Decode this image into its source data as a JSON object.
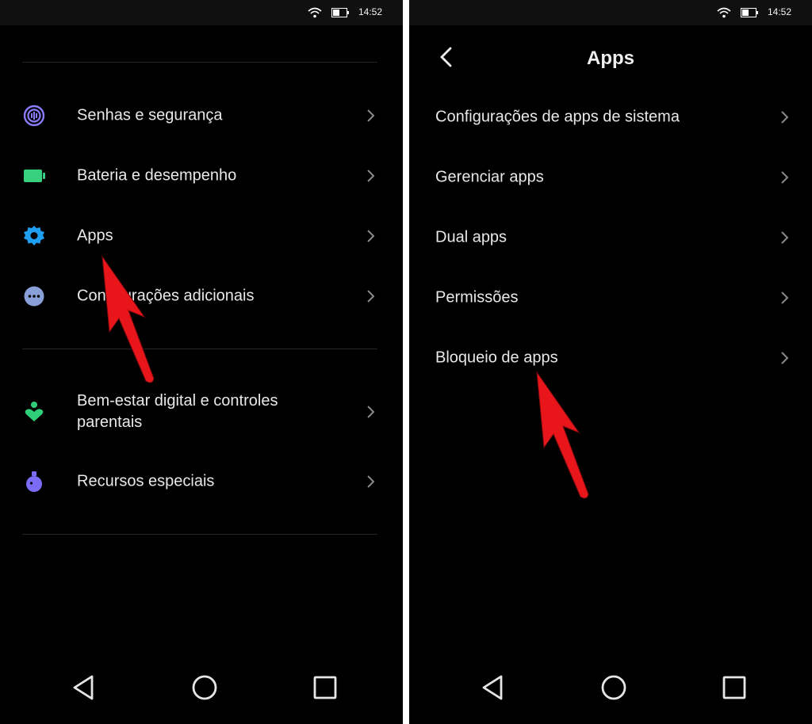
{
  "left_screen": {
    "status_time": "14:52",
    "items": [
      {
        "label": "Senhas e segurança",
        "icon": "fingerprint-icon",
        "icon_color": "#8b7cff"
      },
      {
        "label": "Bateria e desempenho",
        "icon": "battery-icon",
        "icon_color": "#36d07f"
      },
      {
        "label": "Apps",
        "icon": "gear-icon",
        "icon_color": "#1e9ff2"
      },
      {
        "label": "Configurações adicionais",
        "icon": "more-dots-icon",
        "icon_color": "#8aa0d8"
      },
      {
        "label": "Bem-estar digital e controles parentais",
        "icon": "wellbeing-icon",
        "icon_color": "#2fcf7a"
      },
      {
        "label": "Recursos especiais",
        "icon": "flask-icon",
        "icon_color": "#7a6cf5"
      }
    ]
  },
  "right_screen": {
    "status_time": "14:52",
    "title": "Apps",
    "items": [
      {
        "label": "Configurações de apps de sistema"
      },
      {
        "label": "Gerenciar apps"
      },
      {
        "label": "Dual apps"
      },
      {
        "label": "Permissões"
      },
      {
        "label": "Bloqueio de apps"
      }
    ]
  },
  "colors": {
    "background": "#000000",
    "text": "#e8e8e8",
    "chevron": "#8a8a8a",
    "divider": "#262626",
    "annotation_arrow": "#e8161b"
  }
}
